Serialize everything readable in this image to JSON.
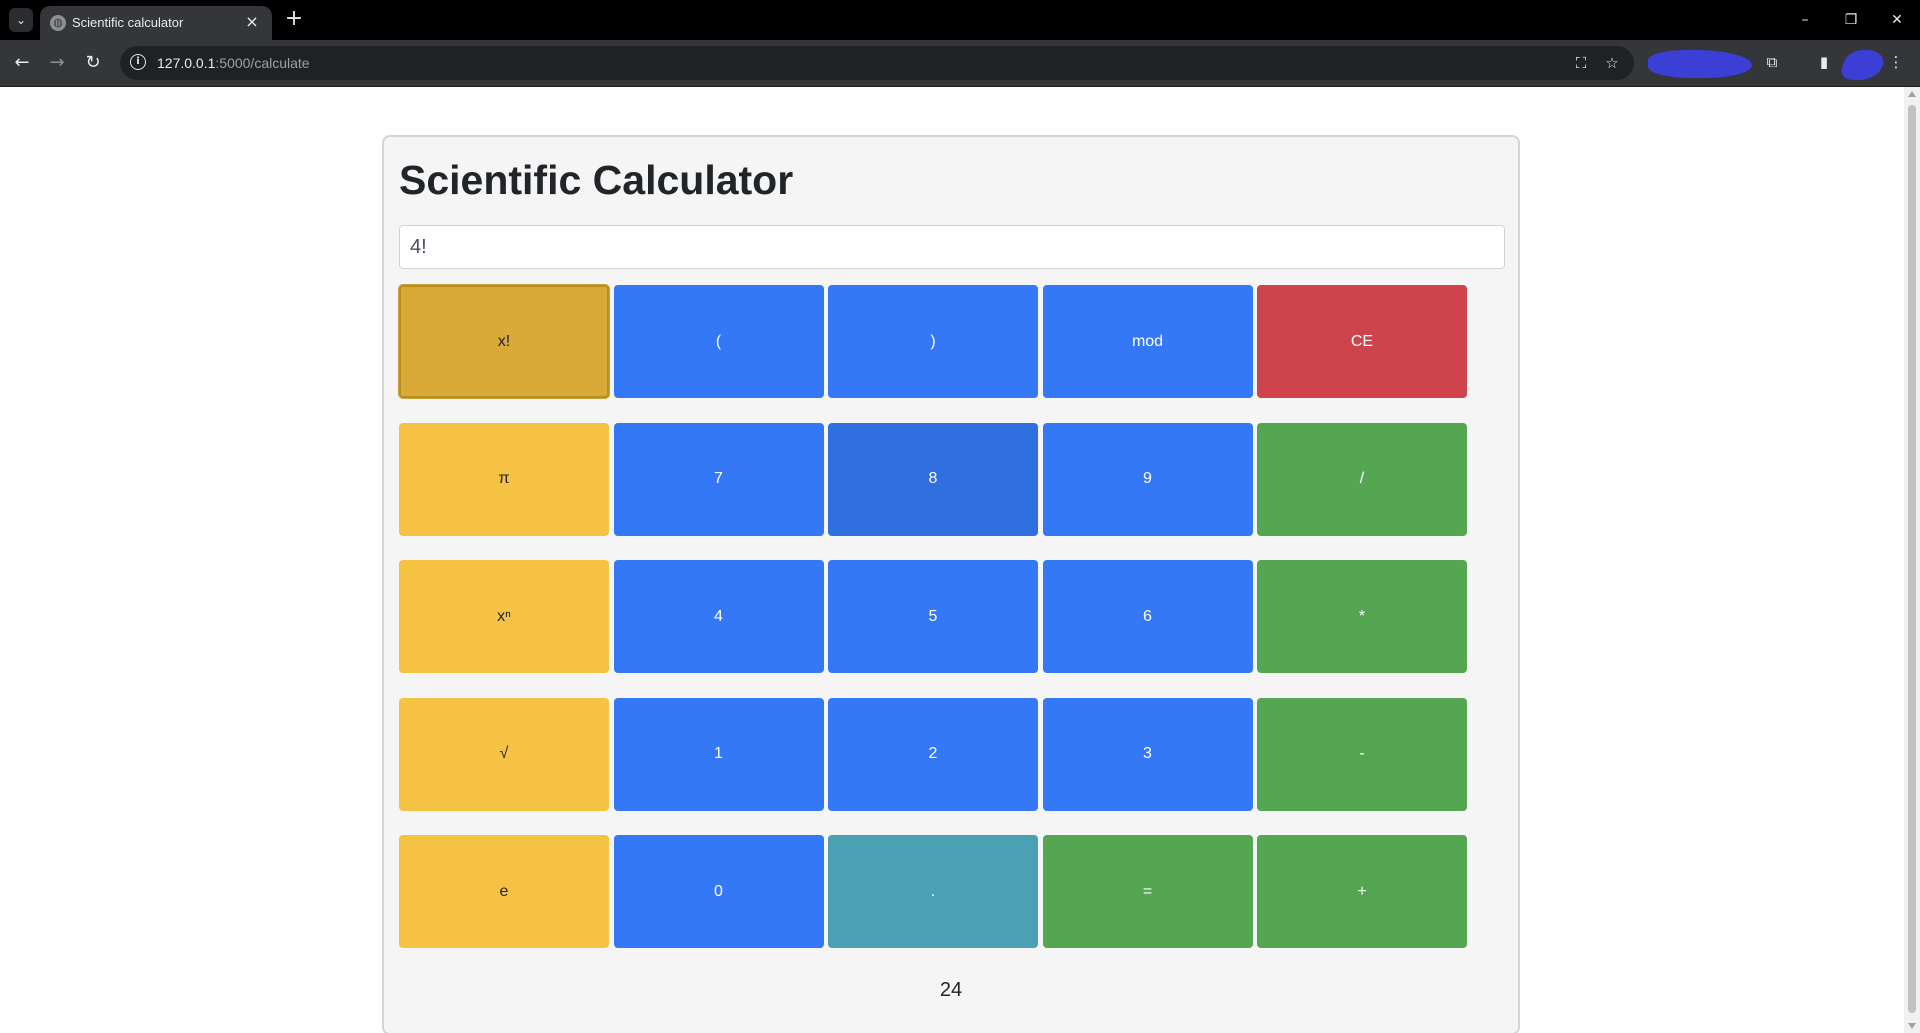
{
  "browser": {
    "tab_title": "Scientific calculator",
    "url_host": "127.0.0.1",
    "url_rest": ":5000/calculate"
  },
  "page": {
    "title": "Scientific Calculator",
    "display_value": "4!",
    "result": "24"
  },
  "colors": {
    "function_key": "#f6c244",
    "function_key_active": "#d9aa38",
    "digit_key": "#3478f5",
    "digit_key_hover": "#2f6fe0",
    "operator_key": "#54a653",
    "clear_key": "#cf434c",
    "decimal_key": "#4ba0b4"
  },
  "keys": [
    [
      {
        "label": "x!",
        "kind": "function_key_active",
        "name": "factorial-button"
      },
      {
        "label": "(",
        "kind": "digit_key",
        "name": "open-paren-button"
      },
      {
        "label": ")",
        "kind": "digit_key",
        "name": "close-paren-button"
      },
      {
        "label": "mod",
        "kind": "digit_key",
        "name": "mod-button"
      },
      {
        "label": "CE",
        "kind": "clear_key",
        "name": "clear-entry-button"
      }
    ],
    [
      {
        "label": "π",
        "kind": "function_key",
        "name": "pi-button"
      },
      {
        "label": "7",
        "kind": "digit_key",
        "name": "digit-7-button"
      },
      {
        "label": "8",
        "kind": "digit_key_hover",
        "name": "digit-8-button"
      },
      {
        "label": "9",
        "kind": "digit_key",
        "name": "digit-9-button"
      },
      {
        "label": "/",
        "kind": "operator_key",
        "name": "divide-button"
      }
    ],
    [
      {
        "label": "xⁿ",
        "kind": "function_key",
        "name": "power-button"
      },
      {
        "label": "4",
        "kind": "digit_key",
        "name": "digit-4-button"
      },
      {
        "label": "5",
        "kind": "digit_key",
        "name": "digit-5-button"
      },
      {
        "label": "6",
        "kind": "digit_key",
        "name": "digit-6-button"
      },
      {
        "label": "*",
        "kind": "operator_key",
        "name": "multiply-button"
      }
    ],
    [
      {
        "label": "√",
        "kind": "function_key",
        "name": "sqrt-button"
      },
      {
        "label": "1",
        "kind": "digit_key",
        "name": "digit-1-button"
      },
      {
        "label": "2",
        "kind": "digit_key",
        "name": "digit-2-button"
      },
      {
        "label": "3",
        "kind": "digit_key",
        "name": "digit-3-button"
      },
      {
        "label": "-",
        "kind": "operator_key",
        "name": "subtract-button"
      }
    ],
    [
      {
        "label": "e",
        "kind": "function_key",
        "name": "euler-button"
      },
      {
        "label": "0",
        "kind": "digit_key",
        "name": "digit-0-button"
      },
      {
        "label": ".",
        "kind": "decimal_key",
        "name": "decimal-button"
      },
      {
        "label": "=",
        "kind": "operator_key",
        "name": "equals-button"
      },
      {
        "label": "+",
        "kind": "operator_key",
        "name": "add-button"
      }
    ]
  ]
}
